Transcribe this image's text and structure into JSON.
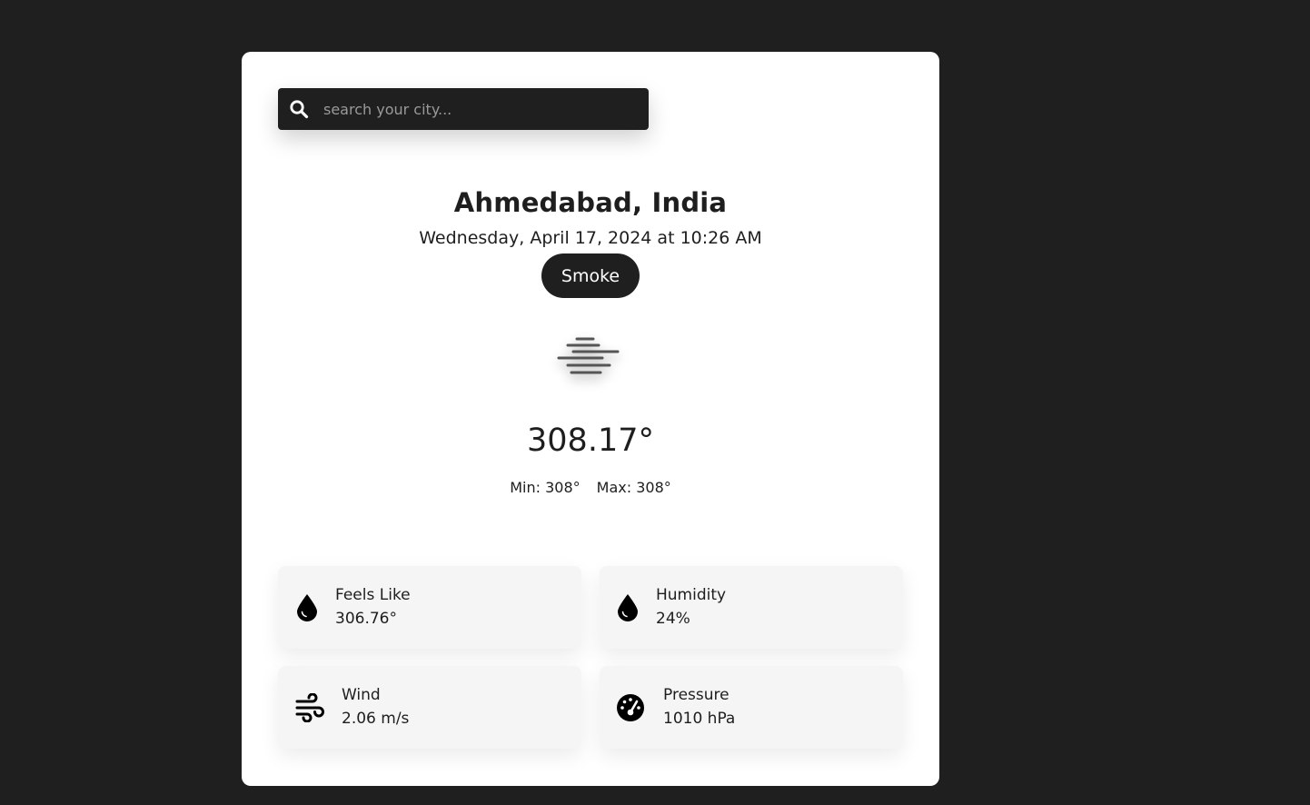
{
  "search": {
    "placeholder": "search your city..."
  },
  "weather": {
    "location": "Ahmedabad, India",
    "datetime": "Wednesday, April 17, 2024 at 10:26 AM",
    "condition": "Smoke",
    "condition_icon": "smoke-haze-icon",
    "temperature": "308.17°",
    "min": "Min: 308°",
    "max": "Max: 308°"
  },
  "details": [
    {
      "label": "Feels Like",
      "value": "306.76°",
      "icon": "droplet-icon"
    },
    {
      "label": "Humidity",
      "value": "24%",
      "icon": "droplet-icon"
    },
    {
      "label": "Wind",
      "value": "2.06 m/s",
      "icon": "wind-icon"
    },
    {
      "label": "Pressure",
      "value": "1010 hPa",
      "icon": "gauge-icon"
    }
  ],
  "colors": {
    "background": "#1f1f1f",
    "card": "#ffffff",
    "tile": "#f5f5f5",
    "accent": "#1f1f1f"
  }
}
